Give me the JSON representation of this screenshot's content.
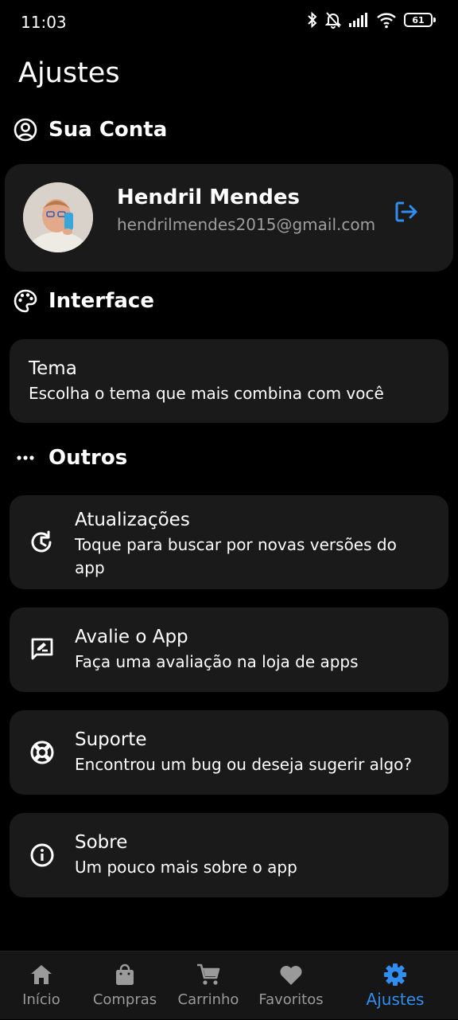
{
  "status_bar": {
    "time": "11:03",
    "battery": "61"
  },
  "page_title": "Ajustes",
  "sections": {
    "account": "Sua Conta",
    "interface": "Interface",
    "others": "Outros"
  },
  "account": {
    "name": "Hendril Mendes",
    "email": "hendrilmendes2015@gmail.com"
  },
  "theme": {
    "title": "Tema",
    "subtitle": "Escolha o tema que mais combina com você"
  },
  "items": [
    {
      "title": "Atualizações",
      "subtitle_line1": "Toque para buscar por novas versões do",
      "subtitle_line2": "app",
      "icon": "refresh-clock-icon"
    },
    {
      "title": "Avalie o App",
      "subtitle_line1": "Faça uma avaliação na loja de apps",
      "icon": "rate-review-icon"
    },
    {
      "title": "Suporte",
      "subtitle_line1": "Encontrou um bug ou deseja sugerir algo?",
      "icon": "lifebuoy-icon"
    },
    {
      "title": "Sobre",
      "subtitle_line1": "Um pouco mais sobre o app",
      "icon": "info-icon"
    }
  ],
  "nav": [
    {
      "label": "Início",
      "icon": "home-icon"
    },
    {
      "label": "Compras",
      "icon": "shopping-bag-icon"
    },
    {
      "label": "Carrinho",
      "icon": "cart-icon"
    },
    {
      "label": "Favoritos",
      "icon": "heart-icon"
    },
    {
      "label": "Ajustes",
      "icon": "gear-icon"
    }
  ],
  "colors": {
    "accent": "#2f8ef0",
    "card": "#1a1a1a",
    "background": "#000000"
  }
}
